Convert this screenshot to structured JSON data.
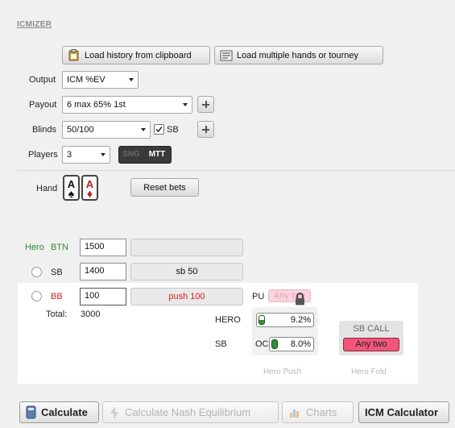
{
  "app": {
    "title": "ICMIZER"
  },
  "toolbar": {
    "load_clipboard": "Load history from clipboard",
    "load_multiple": "Load multiple hands or tourney"
  },
  "settings": {
    "output_label": "Output",
    "output_value": "ICM %EV",
    "payout_label": "Payout",
    "payout_value": "6 max 65% 1st",
    "blinds_label": "Blinds",
    "blinds_value": "50/100",
    "sb_checkbox_label": "SB",
    "sb_checked": true,
    "players_label": "Players",
    "players_value": "3",
    "mode_sng": "SNG",
    "mode_mtt": "MTT"
  },
  "hand": {
    "label": "Hand",
    "cards": [
      {
        "rank": "A",
        "suit": "♠",
        "color": "#111111"
      },
      {
        "rank": "A",
        "suit": "♦",
        "color": "#b22222"
      }
    ],
    "reset_label": "Reset bets"
  },
  "players": [
    {
      "prefix": "Hero",
      "position": "BTN",
      "stack": "1500",
      "action": "",
      "color": "#2e8b2e"
    },
    {
      "prefix": "",
      "position": "SB",
      "stack": "1400",
      "action": "sb 50",
      "color": "#222222"
    },
    {
      "prefix": "",
      "position": "BB",
      "stack": "100",
      "action": "push 100",
      "color": "#d42020"
    }
  ],
  "total": {
    "label": "Total:",
    "value": "3000"
  },
  "results": {
    "pu_label": "PU",
    "pu_range": "Any two",
    "hero_label": "HERO",
    "hero_pct": "9.2%",
    "hero_pct_value": 9.2,
    "sb_label": "SB",
    "oc_label": "OC",
    "oc_pct": "8.0%",
    "oc_pct_value": 8.0,
    "sb_call_label": "SB CALL",
    "sb_call_range": "Any two",
    "hero_push_caption": "Hero Push",
    "hero_fold_caption": "Hero Fold"
  },
  "bottom": {
    "calculate": "Calculate",
    "nash": "Calculate Nash Equilibrium",
    "charts": "Charts",
    "icm_calc": "ICM Calculator"
  }
}
